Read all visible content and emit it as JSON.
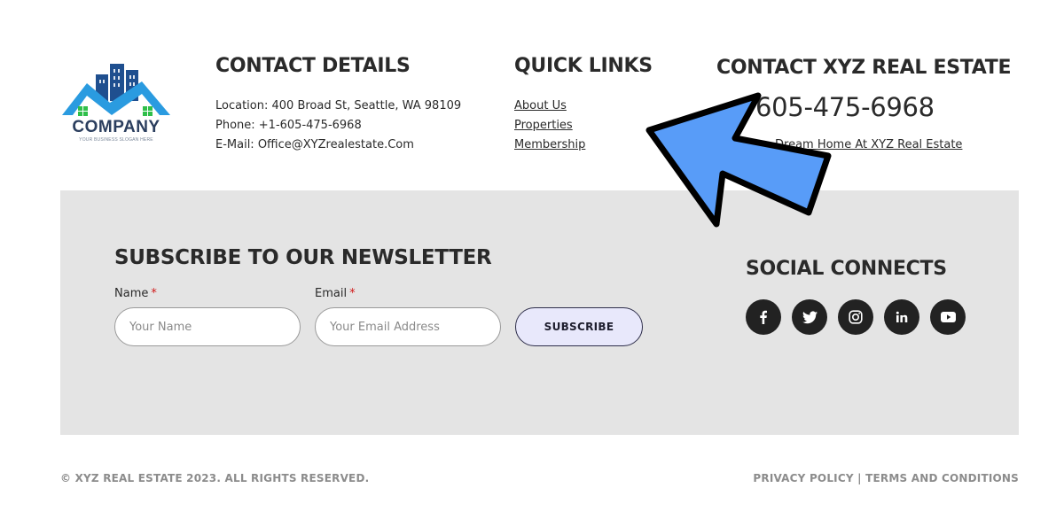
{
  "logo": {
    "word": "COMPANY",
    "slogan": "YOUR BUSINESS SLOGAN HERE",
    "colors": {
      "navy": "#1f4f8f",
      "sky": "#2a9be0",
      "green": "#2fbf4a"
    }
  },
  "contact_details": {
    "title": "CONTACT DETAILS",
    "location": "Location: 400 Broad St, Seattle, WA 98109",
    "phone": "Phone: +1-605-475-6968",
    "email": "E-Mail: Office@XYZrealestate.Com"
  },
  "quick_links": {
    "title": "QUICK LINKS",
    "items": [
      "About Us",
      "Properties",
      "Membership"
    ]
  },
  "contact_xyz": {
    "title": "CONTACT XYZ REAL ESTATE",
    "phone_visible": "605-475-6968",
    "tagline_visible": "Dream Home At XYZ Real Estate"
  },
  "newsletter": {
    "title": "SUBSCRIBE TO OUR NEWSLETTER",
    "name_label": "Name",
    "email_label": "Email",
    "required_mark": "*",
    "name_placeholder": "Your Name",
    "email_placeholder": "Your Email Address",
    "button": "SUBSCRIBE"
  },
  "social": {
    "title": "SOCIAL CONNECTS",
    "icons": [
      "facebook-icon",
      "twitter-icon",
      "instagram-icon",
      "linkedin-icon",
      "youtube-icon"
    ]
  },
  "bottom_bar": {
    "copyright": "© XYZ REAL ESTATE 2023. ALL RIGHTS RESERVED.",
    "privacy": "PRIVACY POLICY",
    "separator": "|",
    "terms": "TERMS AND CONDITIONS"
  },
  "overlay": {
    "arrow_color": "#589cf8",
    "outline_color": "#000000"
  }
}
